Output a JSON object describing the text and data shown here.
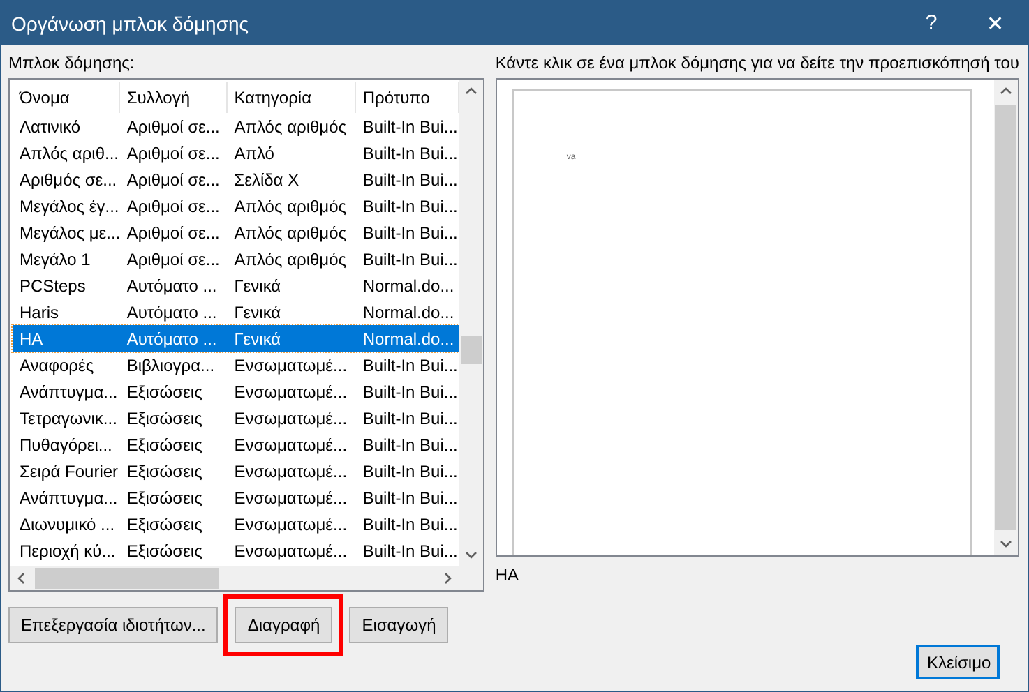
{
  "window": {
    "title": "Οργάνωση μπλοκ δόμησης",
    "help": "?",
    "close": "✕"
  },
  "list_label": "Μπλοκ δόμησης:",
  "table": {
    "columns": [
      "Όνομα",
      "Συλλογή",
      "Κατηγορία",
      "Πρότυπο"
    ],
    "rows": [
      {
        "cells": [
          "Λατινικό",
          "Αριθμοί σε...",
          "Απλός αριθμός",
          "Built-In Bui..."
        ],
        "selected": false
      },
      {
        "cells": [
          "Απλός αριθ...",
          "Αριθμοί σε...",
          "Απλό",
          "Built-In Bui..."
        ],
        "selected": false
      },
      {
        "cells": [
          "Αριθμός σε...",
          "Αριθμοί σε...",
          "Σελίδα X",
          "Built-In Bui..."
        ],
        "selected": false
      },
      {
        "cells": [
          "Μεγάλος έγ...",
          "Αριθμοί σε...",
          "Απλός αριθμός",
          "Built-In Bui..."
        ],
        "selected": false
      },
      {
        "cells": [
          "Μεγάλος με...",
          "Αριθμοί σε...",
          "Απλός αριθμός",
          "Built-In Bui..."
        ],
        "selected": false
      },
      {
        "cells": [
          "Μεγάλο 1",
          "Αριθμοί σε...",
          "Απλός αριθμός",
          "Built-In Bui..."
        ],
        "selected": false
      },
      {
        "cells": [
          "PCSteps",
          "Αυτόματο ...",
          "Γενικά",
          "Normal.do..."
        ],
        "selected": false
      },
      {
        "cells": [
          "Haris",
          "Αυτόματο ...",
          "Γενικά",
          "Normal.do..."
        ],
        "selected": false
      },
      {
        "cells": [
          "HA",
          "Αυτόματο ...",
          "Γενικά",
          "Normal.do..."
        ],
        "selected": true
      },
      {
        "cells": [
          "Αναφορές",
          "Βιβλιογρα...",
          "Ενσωματωμέ...",
          "Built-In Bui..."
        ],
        "selected": false
      },
      {
        "cells": [
          "Ανάπτυγμα...",
          "Εξισώσεις",
          "Ενσωματωμέ...",
          "Built-In Bui..."
        ],
        "selected": false
      },
      {
        "cells": [
          "Τετραγωνικ...",
          "Εξισώσεις",
          "Ενσωματωμέ...",
          "Built-In Bui..."
        ],
        "selected": false
      },
      {
        "cells": [
          "Πυθαγόρει...",
          "Εξισώσεις",
          "Ενσωματωμέ...",
          "Built-In Bui..."
        ],
        "selected": false
      },
      {
        "cells": [
          "Σειρά Fourier",
          "Εξισώσεις",
          "Ενσωματωμέ...",
          "Built-In Bui..."
        ],
        "selected": false
      },
      {
        "cells": [
          "Ανάπτυγμα...",
          "Εξισώσεις",
          "Ενσωματωμέ...",
          "Built-In Bui..."
        ],
        "selected": false
      },
      {
        "cells": [
          "Διωνυμικό ...",
          "Εξισώσεις",
          "Ενσωματωμέ...",
          "Built-In Bui..."
        ],
        "selected": false
      },
      {
        "cells": [
          "Περιοχή κύ...",
          "Εξισώσεις",
          "Ενσωματωμέ...",
          "Built-In Bui..."
        ],
        "selected": false
      }
    ]
  },
  "buttons": [
    {
      "label": "Επεξεργασία ιδιοτήτων...",
      "highlighted": false
    },
    {
      "label": "Διαγραφή",
      "highlighted": true
    },
    {
      "label": "Εισαγωγή",
      "highlighted": false
    }
  ],
  "preview": {
    "label": "Κάντε κλικ σε ένα μπλοκ δόμησης για να δείτε την προεπισκόπησή του",
    "content": "va",
    "name": "HA"
  },
  "close_button": "Κλείσιμο"
}
